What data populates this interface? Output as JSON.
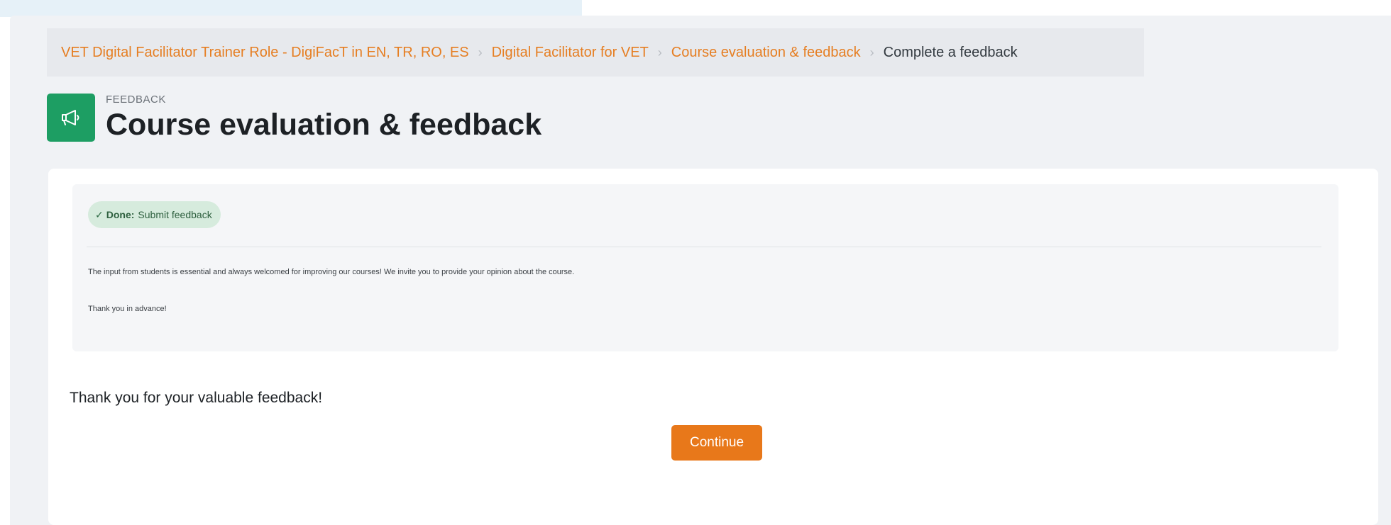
{
  "breadcrumb": {
    "items": [
      "VET Digital Facilitator Trainer Role - DigiFacT in EN, TR, RO, ES",
      "Digital Facilitator for VET",
      "Course evaluation & feedback"
    ],
    "current": "Complete a feedback"
  },
  "header": {
    "module_type": "FEEDBACK",
    "title": "Course evaluation & feedback",
    "icon": "megaphone-icon"
  },
  "completion": {
    "status": "Done:",
    "label": "Submit feedback"
  },
  "intro": {
    "paragraph1": "The input from students is essential and always welcomed for improving our courses! We invite you to provide your opinion about the course.",
    "paragraph2": "Thank you in advance!"
  },
  "main": {
    "thanks_message": "Thank you for your valuable feedback!",
    "continue_label": "Continue"
  },
  "colors": {
    "accent": "#e8781a",
    "link": "#e67e22",
    "module_icon_bg": "#1d9e63",
    "completion_bg": "#d6ebdd"
  }
}
